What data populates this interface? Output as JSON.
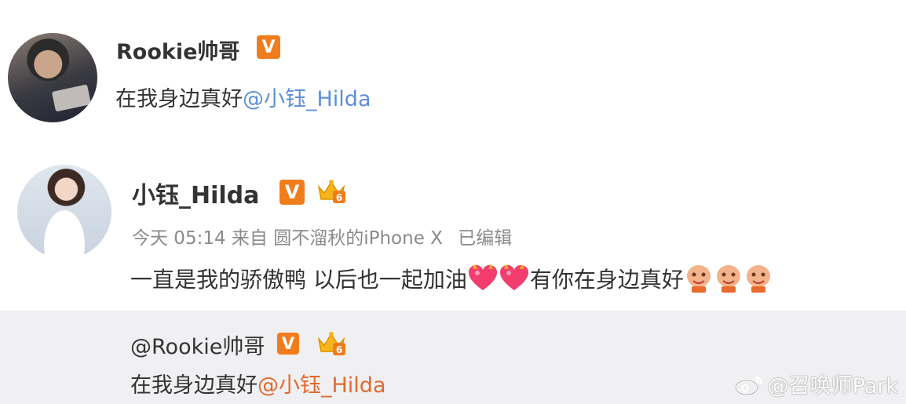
{
  "post": {
    "author": "Rookie帅哥",
    "text": "在我身边真好",
    "mention": "@小钰_Hilda"
  },
  "reply": {
    "author": "小钰_Hilda",
    "meta": {
      "time": "今天 05:14",
      "source_prefix": "来自",
      "source": "圆不溜秋的iPhone X",
      "edited": "已编辑"
    },
    "text_part1": "一直是我的骄傲鸭 以后也一起加油",
    "text_part2": "有你在身边真好",
    "icons": {
      "verified": "verified-v-icon",
      "member": "crown-member-icon",
      "emoji_heart": "heart-emoji-icon",
      "emoji_face": "face-emoji-icon"
    }
  },
  "repost": {
    "author": "@Rookie帅哥",
    "text": "在我身边真好",
    "mention": "@小钰_Hilda"
  },
  "badge_label": "V",
  "crown_level": "6",
  "watermark": "@召唤师Park",
  "colors": {
    "mention_blue": "#5d8fd8",
    "mention_orange": "#e26a2c",
    "badge_orange": "#f07d1c",
    "repost_bg": "#f0f0f3"
  }
}
